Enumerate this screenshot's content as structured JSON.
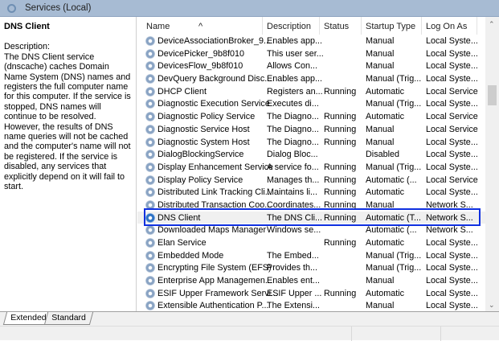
{
  "window": {
    "title": "Services (Local)"
  },
  "details": {
    "service_name": "DNS Client",
    "description_label": "Description:",
    "description": "The DNS Client service (dnscache) caches Domain Name System (DNS) names and registers the full computer name for this computer. If the service is stopped, DNS names will continue to be resolved. However, the results of DNS name queries will not be cached and the computer's name will not be registered. If the service is disabled, any services that explicitly depend on it will fail to start."
  },
  "columns": [
    "Name",
    "Description",
    "Status",
    "Startup Type",
    "Log On As"
  ],
  "selected_index": 14,
  "rows": [
    [
      "DeviceAssociationBroker_9...",
      "Enables app...",
      "",
      "Manual",
      "Local Syste..."
    ],
    [
      "DevicePicker_9b8f010",
      "This user ser...",
      "",
      "Manual",
      "Local Syste..."
    ],
    [
      "DevicesFlow_9b8f010",
      "Allows Con...",
      "",
      "Manual",
      "Local Syste..."
    ],
    [
      "DevQuery Background Disc...",
      "Enables app...",
      "",
      "Manual (Trig...",
      "Local Syste..."
    ],
    [
      "DHCP Client",
      "Registers an...",
      "Running",
      "Automatic",
      "Local Service"
    ],
    [
      "Diagnostic Execution Service",
      "Executes di...",
      "",
      "Manual (Trig...",
      "Local Syste..."
    ],
    [
      "Diagnostic Policy Service",
      "The Diagno...",
      "Running",
      "Automatic",
      "Local Service"
    ],
    [
      "Diagnostic Service Host",
      "The Diagno...",
      "Running",
      "Manual",
      "Local Service"
    ],
    [
      "Diagnostic System Host",
      "The Diagno...",
      "Running",
      "Manual",
      "Local Syste..."
    ],
    [
      "DialogBlockingService",
      "Dialog Bloc...",
      "",
      "Disabled",
      "Local Syste..."
    ],
    [
      "Display Enhancement Service",
      "A service fo...",
      "Running",
      "Manual (Trig...",
      "Local Syste..."
    ],
    [
      "Display Policy Service",
      "Manages th...",
      "Running",
      "Automatic (...",
      "Local Service"
    ],
    [
      "Distributed Link Tracking Cli...",
      "Maintains li...",
      "Running",
      "Automatic",
      "Local Syste..."
    ],
    [
      "Distributed Transaction Coo...",
      "Coordinates...",
      "Running",
      "Manual",
      "Network S..."
    ],
    [
      "DNS Client",
      "The DNS Cli...",
      "Running",
      "Automatic (T...",
      "Network S..."
    ],
    [
      "Downloaded Maps Manager",
      "Windows se...",
      "",
      "Automatic (...",
      "Network S..."
    ],
    [
      "Elan Service",
      "",
      "Running",
      "Automatic",
      "Local Syste..."
    ],
    [
      "Embedded Mode",
      "The Embed...",
      "",
      "Manual (Trig...",
      "Local Syste..."
    ],
    [
      "Encrypting File System (EFS)",
      "Provides th...",
      "",
      "Manual (Trig...",
      "Local Syste..."
    ],
    [
      "Enterprise App Managemen...",
      "Enables ent...",
      "",
      "Manual",
      "Local Syste..."
    ],
    [
      "ESIF Upper Framework Servi...",
      "ESIF Upper ...",
      "Running",
      "Automatic",
      "Local Syste..."
    ],
    [
      "Extensible Authentication P...",
      "The Extensi...",
      "",
      "Manual",
      "Local Syste..."
    ]
  ],
  "tabs": [
    "Extended",
    "Standard"
  ],
  "active_tab": "Extended",
  "colors": {
    "selection_outline": "#1030e0",
    "titlebar": "#a7bbd3"
  }
}
